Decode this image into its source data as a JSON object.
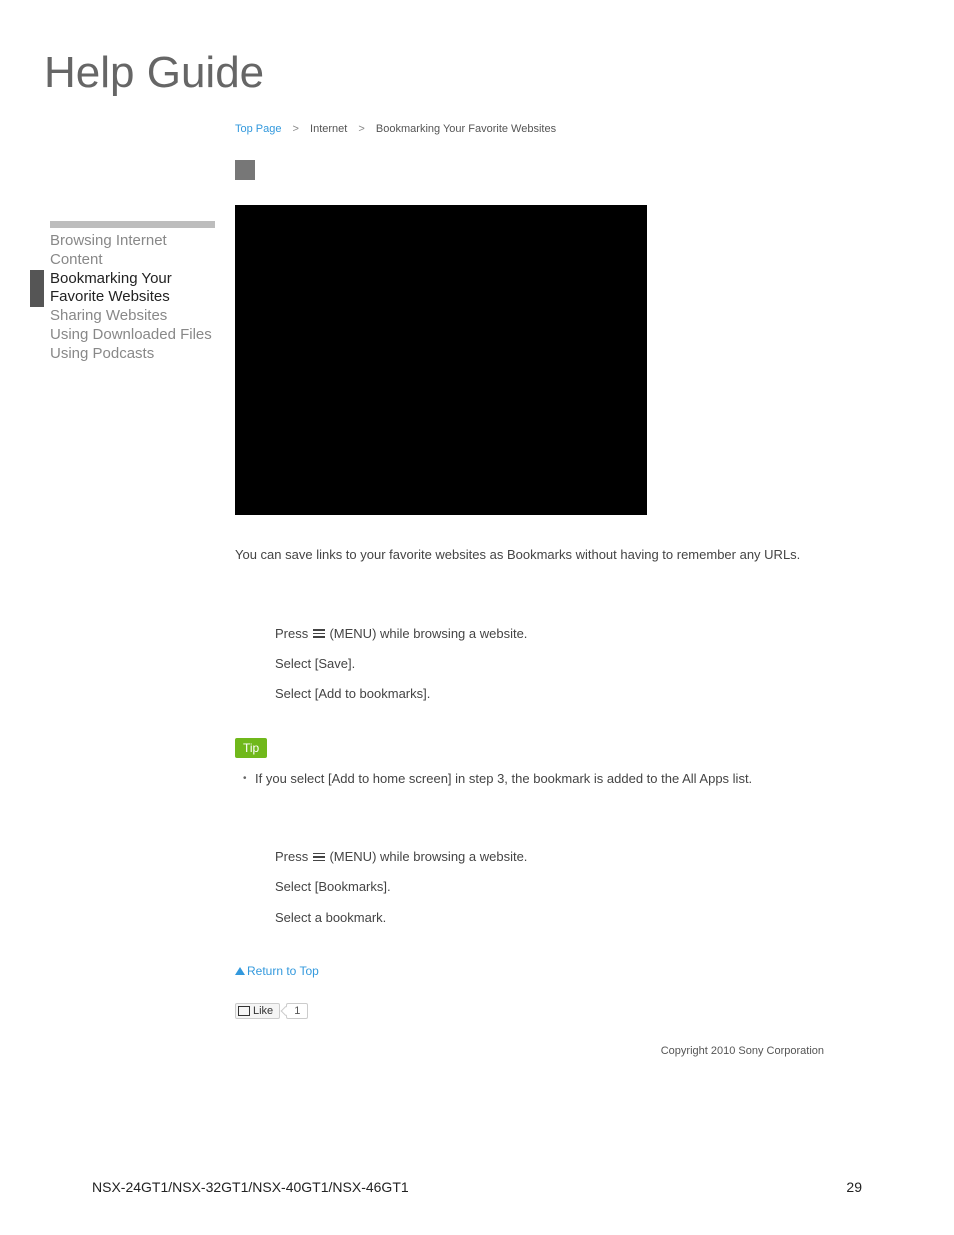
{
  "header": {
    "title": "Help Guide"
  },
  "breadcrumb": {
    "top": "Top Page",
    "mid": "Internet",
    "current": "Bookmarking Your Favorite Websites",
    "sep": ">"
  },
  "sidebar": {
    "items": [
      {
        "label": "Browsing Internet Content",
        "active": false
      },
      {
        "label": "Bookmarking Your Favorite Websites",
        "active": true
      },
      {
        "label": "Sharing Websites",
        "active": false
      },
      {
        "label": "Using Downloaded Files",
        "active": false
      },
      {
        "label": "Using Podcasts",
        "active": false
      }
    ]
  },
  "content": {
    "intro": "You can save links to your favorite websites as Bookmarks without having to remember any URLs.",
    "steps1": {
      "s1_pre": "Press ",
      "s1_post": "(MENU) while browsing a website.",
      "s2": "Select [Save].",
      "s3": "Select [Add to bookmarks]."
    },
    "tip_label": "Tip",
    "tip_text": "If you select [Add to home screen] in step 3, the bookmark is added to the All Apps list.",
    "steps2": {
      "s1_pre": "Press ",
      "s1_post": "(MENU) while browsing a website.",
      "s2": "Select [Bookmarks].",
      "s3": "Select a bookmark."
    },
    "return_top": "Return to Top",
    "like_label": "Like",
    "like_count": "1"
  },
  "footer": {
    "copyright": "Copyright 2010 Sony Corporation",
    "model": "NSX-24GT1/NSX-32GT1/NSX-40GT1/NSX-46GT1",
    "page": "29"
  }
}
